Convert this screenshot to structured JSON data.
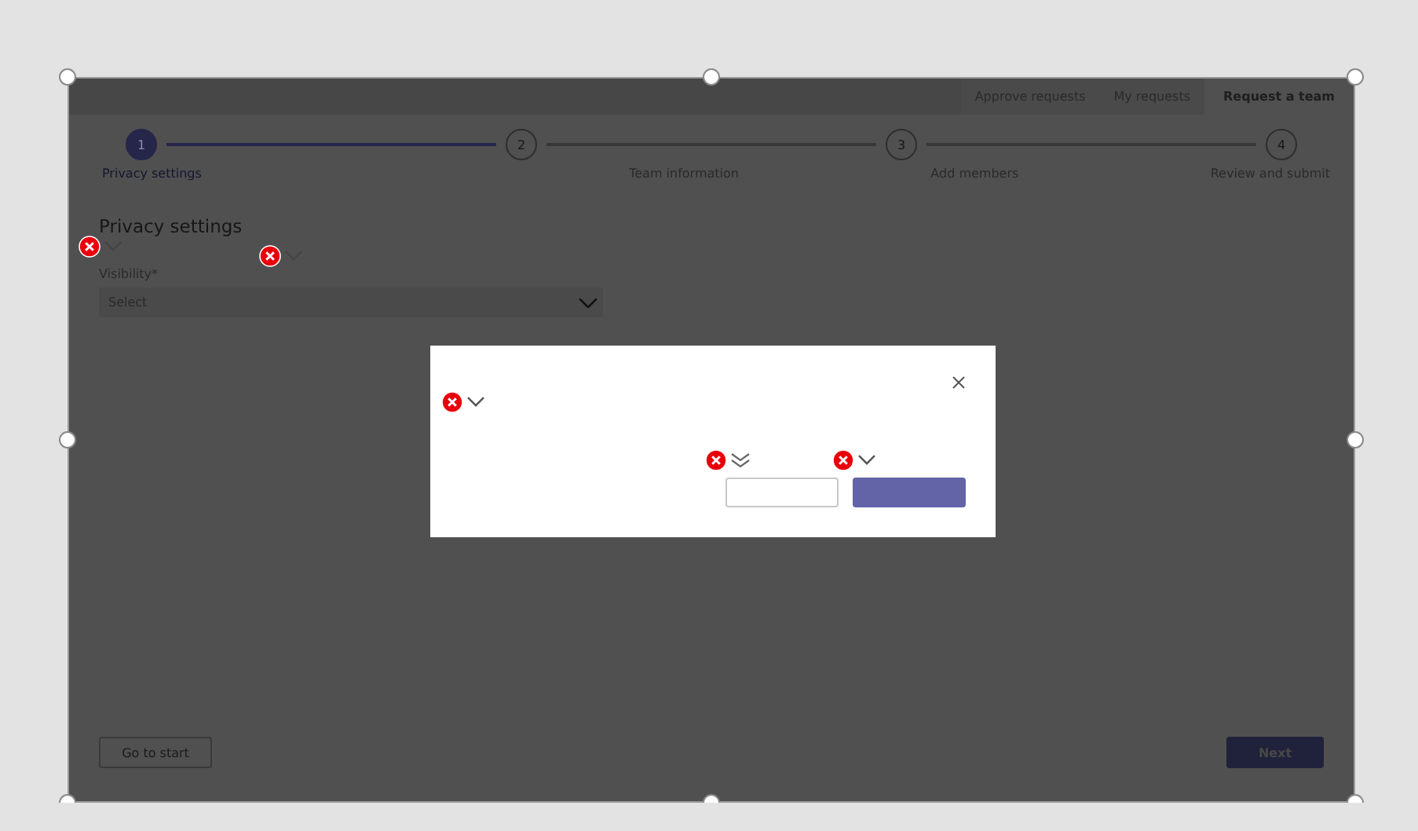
{
  "nav_tabs": [
    {
      "label": "Approve requests",
      "selected": false
    },
    {
      "label": "My requests",
      "selected": false
    },
    {
      "label": "Request a team",
      "selected": true
    }
  ],
  "steps": [
    {
      "number": "1",
      "label": "Privacy settings",
      "selected": true
    },
    {
      "number": "2",
      "label": "Team information",
      "selected": false
    },
    {
      "number": "3",
      "label": "Add members",
      "selected": false
    },
    {
      "number": "4",
      "label": "Review and submit",
      "selected": false
    }
  ],
  "section_title": "Privacy settings",
  "visibility": {
    "label": "Visibility*",
    "placeholder": "Select"
  },
  "buttons": {
    "back": "Go to start",
    "next": "Next"
  }
}
